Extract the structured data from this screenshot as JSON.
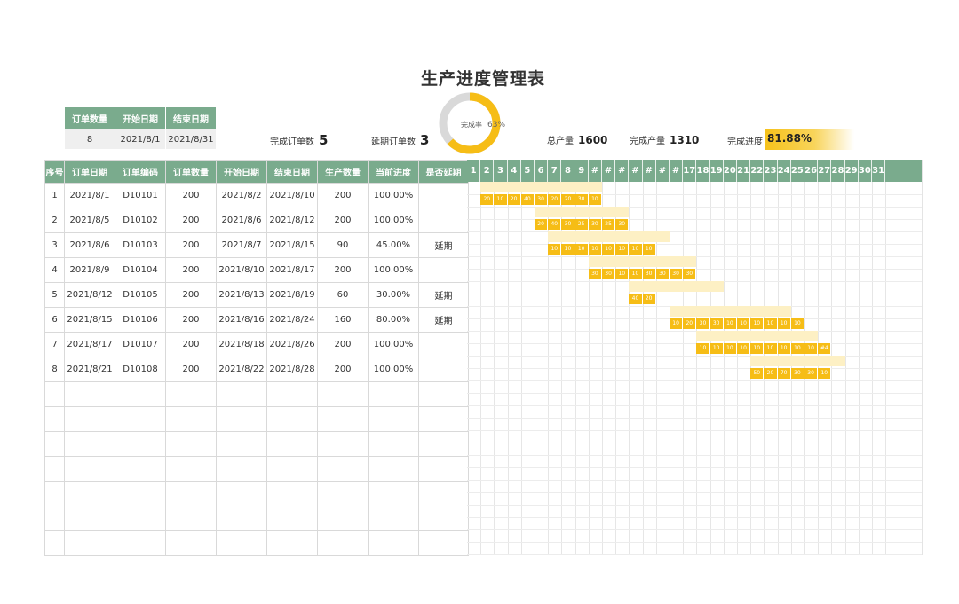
{
  "title": "生产进度管理表",
  "summary": {
    "headers": [
      "订单数量",
      "开始日期",
      "结束日期"
    ],
    "values": [
      "8",
      "2021/8/1",
      "2021/8/31"
    ]
  },
  "stats": {
    "done_orders_label": "完成订单数",
    "done_orders": "5",
    "delayed_orders_label": "延期订单数",
    "delayed_orders": "3",
    "total_output_label": "总产量",
    "total_output": "1600",
    "done_output_label": "完成产量",
    "done_output": "1310",
    "progress_label": "完成进度",
    "progress": "81.88%"
  },
  "donut": {
    "label": "完成率",
    "pct": "63%",
    "fraction": 0.63,
    "color": "#f6bd16",
    "track": "#d9d9d9"
  },
  "table": {
    "headers": [
      "序号",
      "订单日期",
      "订单编码",
      "订单数量",
      "开始日期",
      "结束日期",
      "生产数量",
      "当前进度",
      "是否延期"
    ],
    "rows": [
      [
        "1",
        "2021/8/1",
        "D10101",
        "200",
        "2021/8/2",
        "2021/8/10",
        "200",
        "100.00%",
        ""
      ],
      [
        "2",
        "2021/8/5",
        "D10102",
        "200",
        "2021/8/6",
        "2021/8/12",
        "200",
        "100.00%",
        ""
      ],
      [
        "3",
        "2021/8/6",
        "D10103",
        "200",
        "2021/8/7",
        "2021/8/15",
        "90",
        "45.00%",
        "延期"
      ],
      [
        "4",
        "2021/8/9",
        "D10104",
        "200",
        "2021/8/10",
        "2021/8/17",
        "200",
        "100.00%",
        ""
      ],
      [
        "5",
        "2021/8/12",
        "D10105",
        "200",
        "2021/8/13",
        "2021/8/19",
        "60",
        "30.00%",
        "延期"
      ],
      [
        "6",
        "2021/8/15",
        "D10106",
        "200",
        "2021/8/16",
        "2021/8/24",
        "160",
        "80.00%",
        "延期"
      ],
      [
        "7",
        "2021/8/17",
        "D10107",
        "200",
        "2021/8/18",
        "2021/8/26",
        "200",
        "100.00%",
        ""
      ],
      [
        "8",
        "2021/8/21",
        "D10108",
        "200",
        "2021/8/22",
        "2021/8/28",
        "200",
        "100.00%",
        ""
      ]
    ],
    "empty_rows": 7
  },
  "gantt": {
    "days": [
      "1",
      "2",
      "3",
      "4",
      "5",
      "6",
      "7",
      "8",
      "9",
      "#",
      "#",
      "#",
      "#",
      "#",
      "#",
      "#",
      "17",
      "18",
      "19",
      "20",
      "21",
      "22",
      "23",
      "24",
      "25",
      "26",
      "27",
      "28",
      "29",
      "30",
      "31"
    ],
    "orders": [
      {
        "start": 2,
        "end": 10,
        "daily": [
          "20",
          "10",
          "20",
          "40",
          "30",
          "20",
          "20",
          "30",
          "10"
        ]
      },
      {
        "start": 6,
        "end": 12,
        "daily": [
          "20",
          "40",
          "30",
          "25",
          "30",
          "25",
          "30"
        ]
      },
      {
        "start": 7,
        "end": 15,
        "daily": [
          "10",
          "10",
          "10",
          "10",
          "10",
          "10",
          "10",
          "10"
        ]
      },
      {
        "start": 10,
        "end": 17,
        "daily": [
          "30",
          "30",
          "10",
          "10",
          "30",
          "30",
          "30",
          "30"
        ]
      },
      {
        "start": 13,
        "end": 19,
        "daily": [
          "40",
          "20"
        ]
      },
      {
        "start": 16,
        "end": 24,
        "daily": [
          "10",
          "20",
          "30",
          "30",
          "10",
          "10",
          "10",
          "10",
          "10",
          "10"
        ]
      },
      {
        "start": 18,
        "end": 26,
        "daily": [
          "10",
          "10",
          "10",
          "10",
          "10",
          "10",
          "10",
          "10",
          "10",
          "#4"
        ]
      },
      {
        "start": 22,
        "end": 28,
        "daily": [
          "50",
          "20",
          "70",
          "30",
          "30",
          "10"
        ]
      }
    ]
  }
}
